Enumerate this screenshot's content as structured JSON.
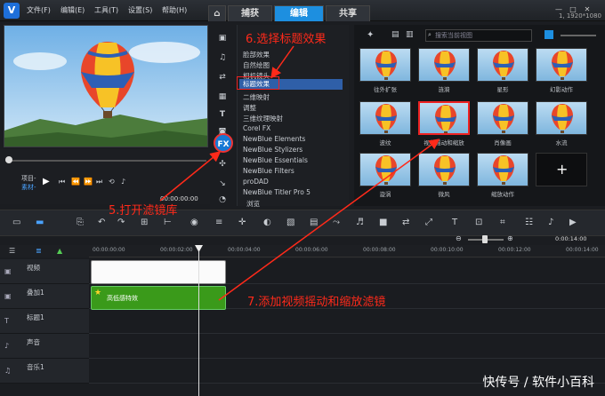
{
  "titlebar": {
    "menus": [
      "文件(F)",
      "编辑(E)",
      "工具(T)",
      "设置(S)",
      "帮助(H)"
    ],
    "home_icon": "home-icon",
    "tabs": [
      "捕获",
      "编辑",
      "共享"
    ],
    "active_tab": "编辑",
    "resolution": "1, 1920*1080"
  },
  "player": {
    "project_label": "项目-",
    "clip_label": "素材-",
    "timecode": "00:00:00:00"
  },
  "effect_list": {
    "items": [
      "脸部效果",
      "自然绘图",
      "相机镜头",
      "标题效果",
      "二维映射",
      "调整",
      "三维纹理映射",
      "Corel FX",
      "NewBlue Elements",
      "NewBlue Stylizers",
      "NewBlue Essentials",
      "NewBlue Filters",
      "proDAD",
      "NewBlue Titler Pro 5",
      "浏览"
    ],
    "selected": "标题效果"
  },
  "gallery": {
    "search_placeholder": "搜索当前视图",
    "thumbnails": [
      "往外扩张",
      "涟漪",
      "星形",
      "幻影动作",
      "波纹",
      "视频摇动和缩放",
      "肖像画",
      "水流",
      "漩涡",
      "微风",
      "缩放动作",
      "+"
    ],
    "selected": "视频摇动和缩放"
  },
  "timeline": {
    "ruler": [
      "00:00:00:00",
      "00:00:02:00",
      "00:00:04:00",
      "00:00:06:00",
      "00:00:08:00",
      "00:00:10:00",
      "00:00:12:00",
      "00:00:14:00"
    ],
    "zoom_timecode": "0:00:14:00",
    "tracks": [
      "视频",
      "叠加1",
      "标题1",
      "声音",
      "音乐1"
    ],
    "overlay_clip": "高低感特效"
  },
  "annotations": {
    "step5": "5.打开滤镜库",
    "step6": "6.选择标题效果",
    "step7": "7.添加视频摇动和缩放滤镜"
  },
  "watermark": "快传号 / 软件小百科",
  "colors": {
    "accent": "#1d8fe0",
    "annotation": "#ff2a1a",
    "clip_green": "#3a9a1a"
  }
}
